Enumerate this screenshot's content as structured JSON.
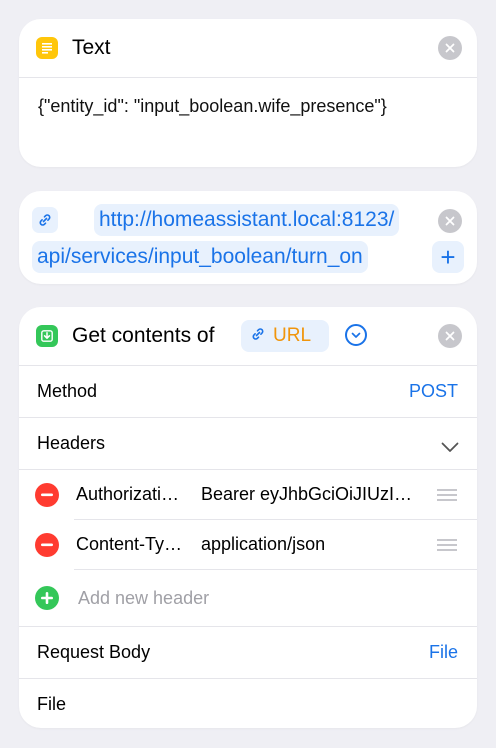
{
  "text_action": {
    "title": "Text",
    "content": "{\"entity_id\": \"input_boolean.wife_presence\"}"
  },
  "url_action": {
    "line1": "http://homeassistant.local:8123/",
    "line2": "api/services/input_boolean/turn_on",
    "add_label": "+"
  },
  "get_contents_action": {
    "title": "Get contents of",
    "url_token": "URL",
    "method": {
      "label": "Method",
      "value": "POST"
    },
    "headers_label": "Headers",
    "headers": [
      {
        "key": "Authorizati…",
        "value": "Bearer eyJhbGciOiJIUzI…"
      },
      {
        "key": "Content-Ty…",
        "value": "application/json"
      }
    ],
    "add_header_placeholder": "Add new header",
    "request_body": {
      "label": "Request Body",
      "value": "File"
    },
    "file_label": "File"
  },
  "colors": {
    "accent": "#1a73e8",
    "token_orange": "#f0950c",
    "text_icon": "#ffc60a",
    "get_icon": "#34c759",
    "remove": "#ff3b30",
    "add": "#34c759"
  }
}
